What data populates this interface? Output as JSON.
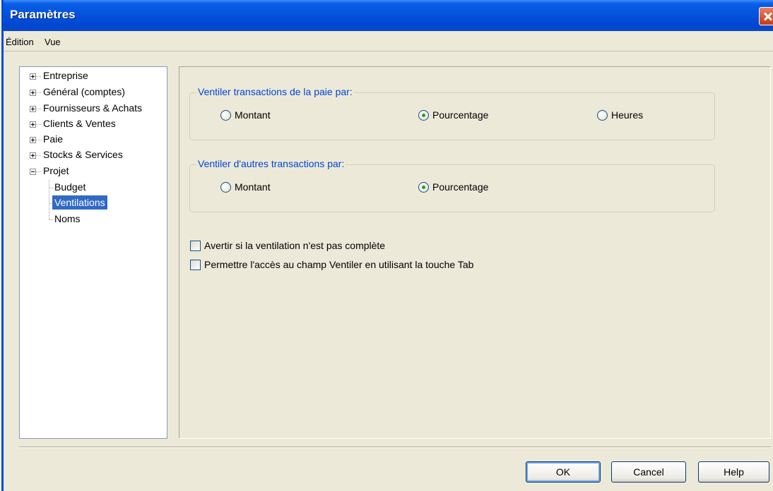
{
  "window": {
    "title": "Paramètres"
  },
  "menu": [
    {
      "label": "Édition"
    },
    {
      "label": "Vue"
    }
  ],
  "tree": [
    {
      "label": "Entreprise",
      "expander": "+"
    },
    {
      "label": "Général (comptes)",
      "expander": "+"
    },
    {
      "label": "Fournisseurs & Achats",
      "expander": "+"
    },
    {
      "label": "Clients & Ventes",
      "expander": "+"
    },
    {
      "label": "Paie",
      "expander": "+"
    },
    {
      "label": "Stocks & Services",
      "expander": "+"
    },
    {
      "label": "Projet",
      "expander": "-"
    },
    {
      "label": "Budget",
      "child": true
    },
    {
      "label": "Ventilations",
      "child": true,
      "selected": true
    },
    {
      "label": "Noms",
      "child": true
    }
  ],
  "groups": {
    "payroll": {
      "title": "Ventiler transactions de la paie par:",
      "options": [
        {
          "label": "Montant",
          "checked": false
        },
        {
          "label": "Pourcentage",
          "checked": true
        },
        {
          "label": "Heures",
          "checked": false
        }
      ]
    },
    "other": {
      "title": "Ventiler d'autres transactions par:",
      "options": [
        {
          "label": "Montant",
          "checked": false
        },
        {
          "label": "Pourcentage",
          "checked": true
        }
      ]
    }
  },
  "checkboxes": [
    {
      "label": "Avertir si la ventilation n'est pas complète",
      "checked": false
    },
    {
      "label": "Permettre l'accès au champ Ventiler en utilisant la touche Tab",
      "checked": false
    }
  ],
  "buttons": {
    "ok": "OK",
    "cancel": "Cancel",
    "help": "Help"
  },
  "colors": {
    "group_title": "#0046d5",
    "selection": "#316ac5",
    "radio_dot": "#21a121"
  }
}
